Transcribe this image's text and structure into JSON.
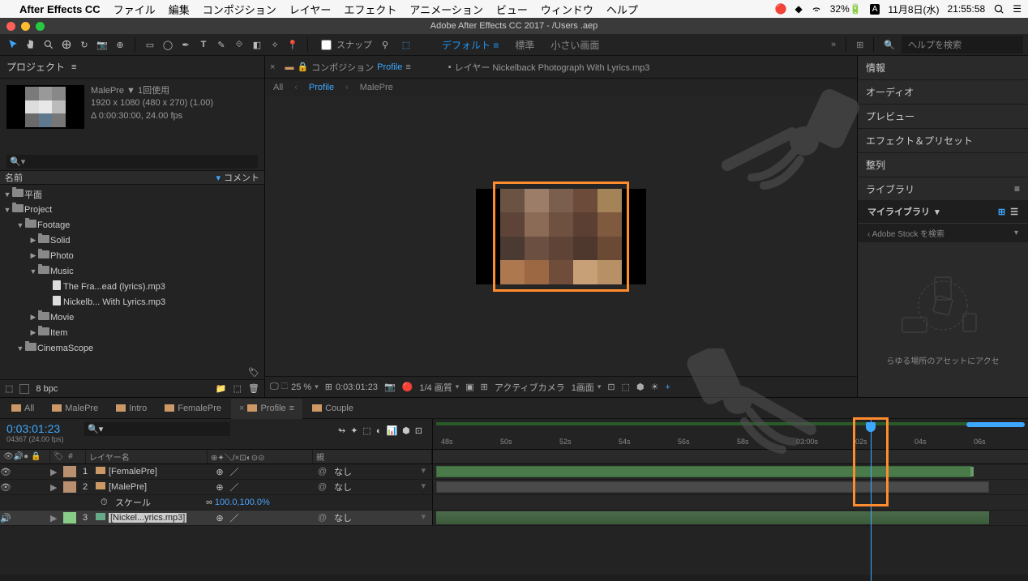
{
  "mac_menu": {
    "app": "After Effects CC",
    "items": [
      "ファイル",
      "編集",
      "コンポジション",
      "レイヤー",
      "エフェクト",
      "アニメーション",
      "ビュー",
      "ウィンドウ",
      "ヘルプ"
    ],
    "battery": "32%",
    "date": "11月8日(水)",
    "time": "21:55:58"
  },
  "window_title": "Adobe After Effects CC 2017 - /Users                                                                           .aep",
  "toolbar": {
    "snap_label": "スナップ",
    "workspaces": [
      "デフォルト",
      "標準",
      "小さい画面"
    ],
    "search_placeholder": "ヘルプを検索"
  },
  "project": {
    "panel_title": "プロジェクト",
    "selected_name": "MalePre ▼  1回使用",
    "selected_dims": "1920 x 1080  (480 x 270) (1.00)",
    "selected_dur": "Δ 0:00:30:00, 24.00 fps",
    "cols": {
      "name": "名前",
      "comment": "コメント"
    },
    "tree": [
      {
        "t": "▼",
        "ic": "folder",
        "lbl": "平面",
        "ind": 0
      },
      {
        "t": "▼",
        "ic": "folder",
        "lbl": "Project",
        "ind": 0
      },
      {
        "t": "▼",
        "ic": "folder",
        "lbl": "Footage",
        "ind": 1
      },
      {
        "t": "▶",
        "ic": "folder",
        "lbl": "Solid",
        "ind": 2
      },
      {
        "t": "▶",
        "ic": "folder",
        "lbl": "Photo",
        "ind": 2
      },
      {
        "t": "▼",
        "ic": "folder",
        "lbl": "Music",
        "ind": 2
      },
      {
        "t": "",
        "ic": "file",
        "lbl": "The Fra...ead (lyrics).mp3",
        "ind": 3
      },
      {
        "t": "",
        "ic": "file",
        "lbl": "Nickelb... With Lyrics.mp3",
        "ind": 3
      },
      {
        "t": "▶",
        "ic": "folder",
        "lbl": "Movie",
        "ind": 2
      },
      {
        "t": "▶",
        "ic": "folder",
        "lbl": "Item",
        "ind": 2
      },
      {
        "t": "▼",
        "ic": "folder",
        "lbl": "CinemaScope",
        "ind": 1
      }
    ],
    "bpc": "8 bpc"
  },
  "comp": {
    "tab1_prefix": "コンポジション",
    "tab1_active": "Profile",
    "tab2": "レイヤー Nickelback   Photograph With Lyrics.mp3",
    "crumbs": [
      "All",
      "Profile",
      "MalePre"
    ],
    "footer": {
      "zoom": "25 %",
      "timecode": "0:03:01:23",
      "quality": "1/4 画質",
      "camera": "アクティブカメラ",
      "view": "1画面"
    }
  },
  "right": {
    "items": [
      "情報",
      "オーディオ",
      "プレビュー",
      "エフェクト＆プリセット",
      "整列"
    ],
    "lib_title": "ライブラリ",
    "lib_selected": "マイライブラリ",
    "stock": "Adobe Stock を検索",
    "msg": "らゆる場所のアセットにアクセ"
  },
  "timeline": {
    "tabs": [
      "All",
      "MalePre",
      "Intro",
      "FemalePre",
      "Profile",
      "Couple"
    ],
    "active_tab": 4,
    "timecode": "0:03:01:23",
    "frames": "04367 (24.00 fps)",
    "col_layer": "レイヤー名",
    "col_parent": "親",
    "ruler": [
      "48s",
      "50s",
      "52s",
      "54s",
      "56s",
      "58s",
      "03:00s",
      "02s",
      "04s",
      "06s"
    ],
    "layers": [
      {
        "num": "1",
        "name": "[FemalePre]",
        "parent": "なし",
        "bar": "green",
        "ic": "comp"
      },
      {
        "num": "2",
        "name": "[MalePre]",
        "parent": "なし",
        "bar": "grey",
        "ic": "comp"
      },
      {
        "num": "3",
        "name": "[Nickel...yrics.mp3]",
        "parent": "なし",
        "bar": "audio",
        "ic": "audio",
        "sel": true
      }
    ],
    "scale_label": "スケール",
    "scale_value": "100.0,100.0%"
  }
}
